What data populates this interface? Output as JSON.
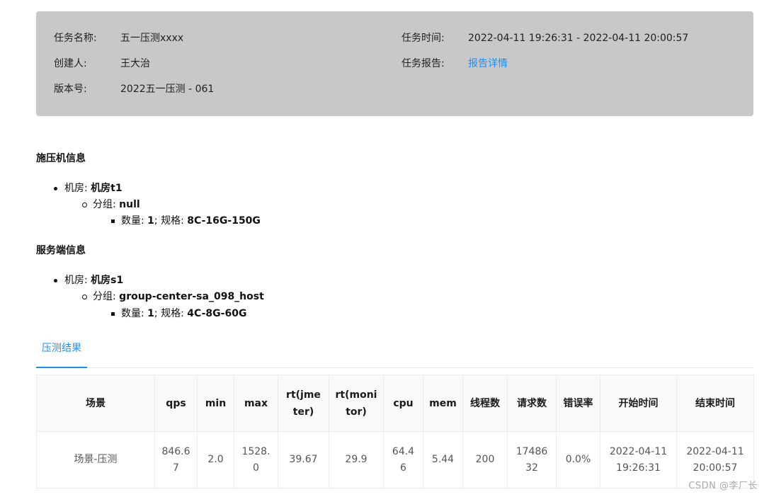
{
  "task_card": {
    "name_label": "任务名称:",
    "name_value": "五一压测xxxx",
    "creator_label": "创建人:",
    "creator_value": "王大治",
    "version_label": "版本号:",
    "version_value": "2022五一压测 - 061",
    "time_label": "任务时间:",
    "time_value": "2022-04-11 19:26:31 - 2022-04-11 20:00:57",
    "report_label": "任务报告:",
    "report_link": "报告详情"
  },
  "load_machines": {
    "title": "施压机信息",
    "room_label": "机房:",
    "room_value": "机房t1",
    "group_label": "分组:",
    "group_value": "null",
    "count_label": "数量:",
    "count_value": "1",
    "spec_label": "; 规格:",
    "spec_value": "8C-16G-150G"
  },
  "server_info": {
    "title": "服务端信息",
    "room_label": "机房:",
    "room_value": "机房s1",
    "group_label": "分组:",
    "group_value": "group-center-sa_098_host",
    "count_label": "数量:",
    "count_value": "1",
    "spec_label": "; 规格:",
    "spec_value": "4C-8G-60G"
  },
  "tabs": [
    {
      "label": "压测结果"
    }
  ],
  "result_table": {
    "headers": [
      "场景",
      "qps",
      "min",
      "max",
      "rt(jmeter)",
      "rt(monitor)",
      "cpu",
      "mem",
      "线程数",
      "请求数",
      "错误率",
      "开始时间",
      "结束时间"
    ],
    "rows": [
      [
        "场景-压测",
        "846.67",
        "2.0",
        "1528.0",
        "39.67",
        "29.9",
        "64.46",
        "5.44",
        "200",
        "1748632",
        "0.0%",
        "2022-04-11 19:26:31",
        "2022-04-11 20:00:57"
      ]
    ]
  },
  "watermark": "CSDN @李厂长"
}
